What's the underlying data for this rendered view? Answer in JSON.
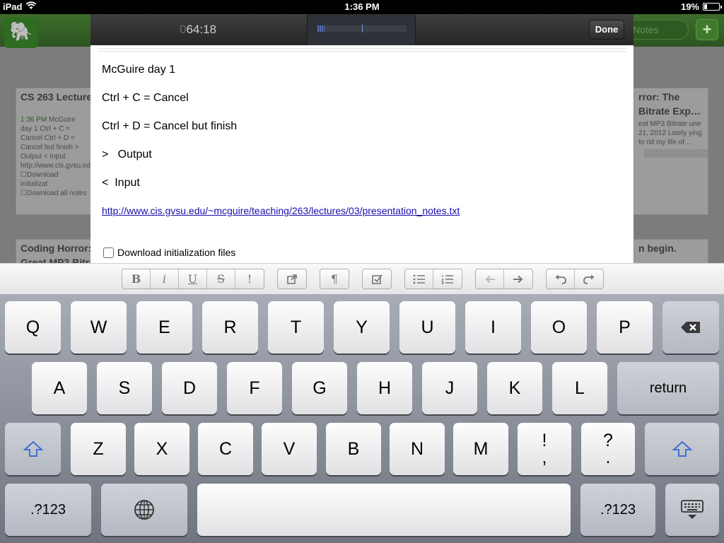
{
  "status_bar": {
    "device": "iPad",
    "time": "1:36 PM",
    "battery": "19%",
    "battery_level": 0.19
  },
  "background_app": {
    "search_placeholder": "Notes",
    "add_label": "+",
    "cards": [
      {
        "title": "CS 263 Lecture",
        "snippet_time": "1:36 PM",
        "snippet": "McGuire day 1 Ctrl + C = Cancel Ctrl + D = Cancel but finish > Output < Input http://www.cis.gvsu.edu/~mcguire/teaching/263/lectures/03/presentation_notes.txt",
        "items": [
          "Download initializat",
          "Download all notes"
        ]
      },
      {
        "title": "Coding Horror:",
        "title2": "Great MP3 Bitra"
      },
      {
        "title": "rror: The",
        "title2": "Bitrate Exp…",
        "snippet": "eat MP3 Bitrate une 21, 2012 Lately ying to rid my life of…"
      },
      {
        "title": "n begin."
      }
    ]
  },
  "recorder": {
    "time_dim": "0",
    "time": "64:18",
    "level": 0.08,
    "done_label": "Done"
  },
  "note": {
    "lines": [
      "McGuire day 1",
      "Ctrl + C = Cancel",
      "Ctrl + D = Cancel but finish",
      ">   Output",
      "<  Input"
    ],
    "link": "http://www.cis.gvsu.edu/~mcguire/teaching/263/lectures/03/presentation_notes.txt",
    "checkbox_label": "Download initialization files",
    "checkbox_checked": false
  },
  "format_toolbar": {
    "groups": [
      [
        "B",
        "i",
        "U",
        "S",
        "!"
      ],
      [
        "external-link-icon"
      ],
      [
        "¶"
      ],
      [
        "checkbox-icon"
      ],
      [
        "bullet-list-icon",
        "numbered-list-icon"
      ],
      [
        "outdent-icon",
        "indent-icon"
      ],
      [
        "undo-icon",
        "redo-icon"
      ]
    ]
  },
  "keyboard": {
    "row1": [
      "Q",
      "W",
      "E",
      "R",
      "T",
      "Y",
      "U",
      "I",
      "O",
      "P"
    ],
    "row2": [
      "A",
      "S",
      "D",
      "F",
      "G",
      "H",
      "J",
      "K",
      "L"
    ],
    "row3": [
      "Z",
      "X",
      "C",
      "V",
      "B",
      "N",
      "M"
    ],
    "return_label": "return",
    "punct1": [
      "!",
      ","
    ],
    "punct2": [
      "?",
      "."
    ],
    "numbers_label": ".?123",
    "icons": {
      "delete": "backspace-icon",
      "shift": "shift-icon",
      "globe": "globe-icon",
      "hide": "keyboard-hide-icon"
    }
  }
}
